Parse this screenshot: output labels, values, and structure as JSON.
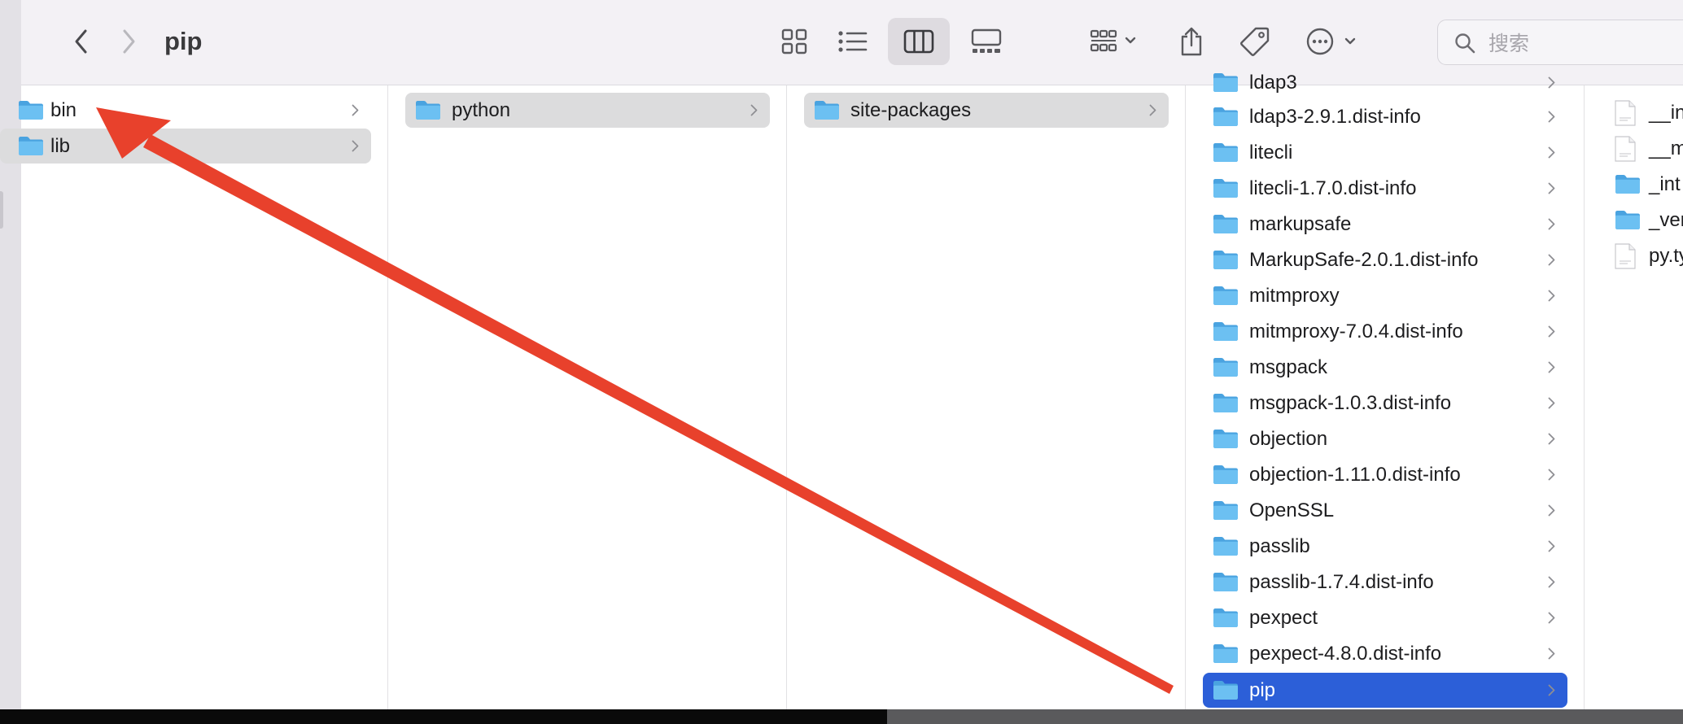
{
  "window": {
    "title": "pip"
  },
  "toolbar": {
    "back_icon": "chevron-left-icon",
    "forward_icon": "chevron-right-icon",
    "view_modes": [
      "icon-view",
      "list-view",
      "column-view",
      "gallery-view"
    ],
    "active_view": "column-view",
    "search_placeholder": "搜索"
  },
  "columns": {
    "col1": [
      {
        "label": "bin",
        "selected": false
      },
      {
        "label": "lib",
        "selected": true
      }
    ],
    "col2": [
      {
        "label": "python",
        "selected": true
      }
    ],
    "col3": [
      {
        "label": "site-packages",
        "selected": true
      }
    ],
    "col4_partial_top": "ldap3",
    "col4": [
      {
        "label": "ldap3-2.9.1.dist-info"
      },
      {
        "label": "litecli"
      },
      {
        "label": "litecli-1.7.0.dist-info"
      },
      {
        "label": "markupsafe"
      },
      {
        "label": "MarkupSafe-2.0.1.dist-info"
      },
      {
        "label": "mitmproxy"
      },
      {
        "label": "mitmproxy-7.0.4.dist-info"
      },
      {
        "label": "msgpack"
      },
      {
        "label": "msgpack-1.0.3.dist-info"
      },
      {
        "label": "objection"
      },
      {
        "label": "objection-1.11.0.dist-info"
      },
      {
        "label": "OpenSSL"
      },
      {
        "label": "passlib"
      },
      {
        "label": "passlib-1.7.4.dist-info"
      },
      {
        "label": "pexpect"
      },
      {
        "label": "pexpect-4.8.0.dist-info"
      },
      {
        "label": "pip",
        "selected": true
      }
    ],
    "col5": [
      {
        "label": "__in",
        "kind": "file"
      },
      {
        "label": "__m",
        "kind": "file"
      },
      {
        "label": "_int",
        "kind": "folder"
      },
      {
        "label": "_ven",
        "kind": "folder"
      },
      {
        "label": "py.ty",
        "kind": "file"
      }
    ]
  },
  "colors": {
    "selection_blue": "#2c5fd8",
    "selection_grey": "#dcdcdd",
    "folder_blue": "#5cb3ec",
    "annotation_arrow": "#e8412c"
  }
}
